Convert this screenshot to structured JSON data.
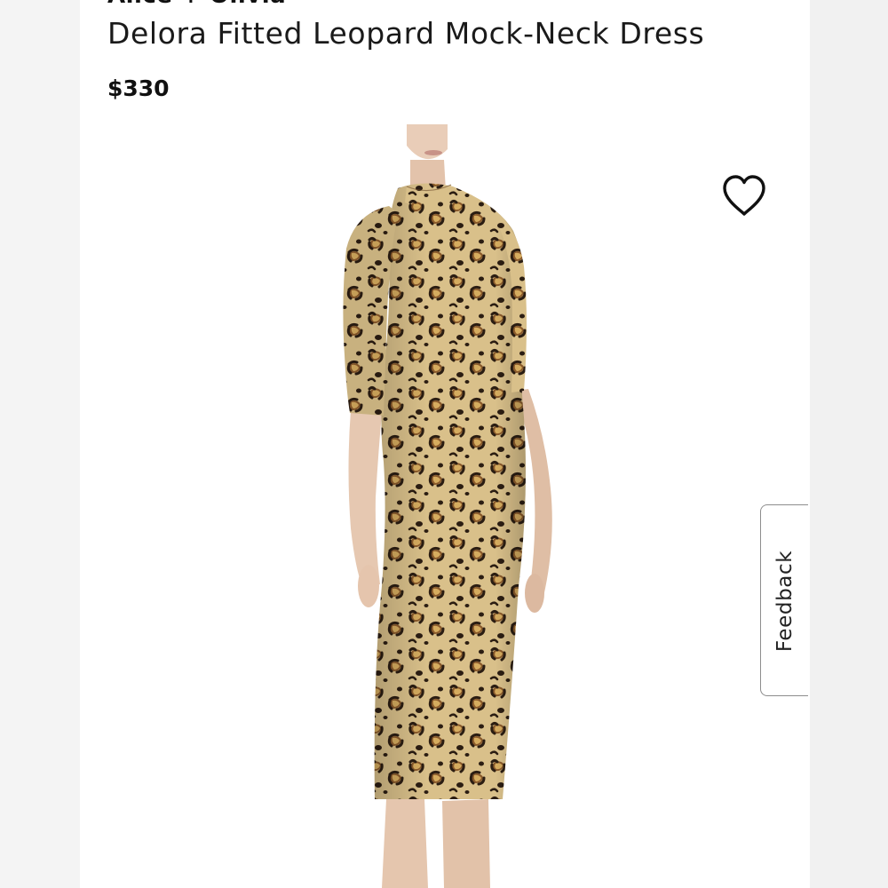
{
  "product": {
    "brand": "Alice + Olivia",
    "title": "Delora Fitted Leopard Mock-Neck Dress",
    "price": "$330"
  },
  "image": {
    "description_icon": "leopard-print-dress-photo"
  },
  "actions": {
    "favorite_icon": "heart-outline-icon",
    "feedback_label": "Feedback"
  },
  "colors": {
    "background": "#ffffff",
    "side_background": "#f3f3f3",
    "text": "#111111",
    "leopard_base": "#d9c08a",
    "leopard_spot": "#2b1d12",
    "leopard_ring": "#8a5a2b",
    "skin": "#e7c9b2"
  }
}
